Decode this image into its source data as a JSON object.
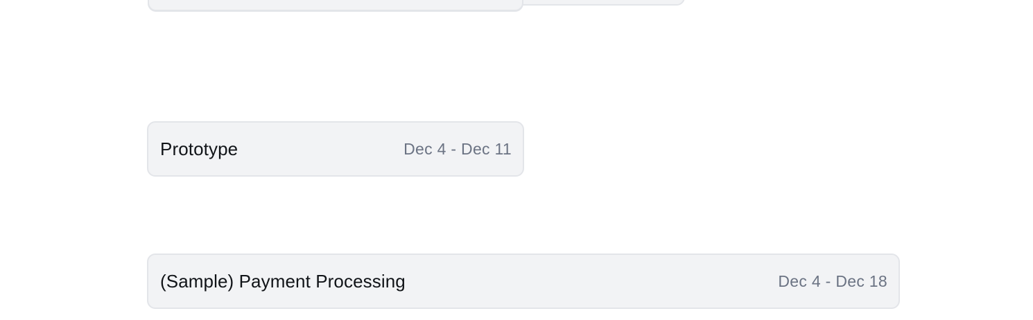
{
  "timeline": {
    "tasks": [
      {
        "title": "Prototype",
        "dates": "Dec 4 - Dec 11"
      },
      {
        "title": "(Sample) Payment Processing",
        "dates": "Dec 4 - Dec 18"
      }
    ]
  },
  "colors": {
    "bar_background": "#f2f3f5",
    "bar_border": "#e3e5e9",
    "title_text": "#111418",
    "date_text": "#6b7383"
  }
}
